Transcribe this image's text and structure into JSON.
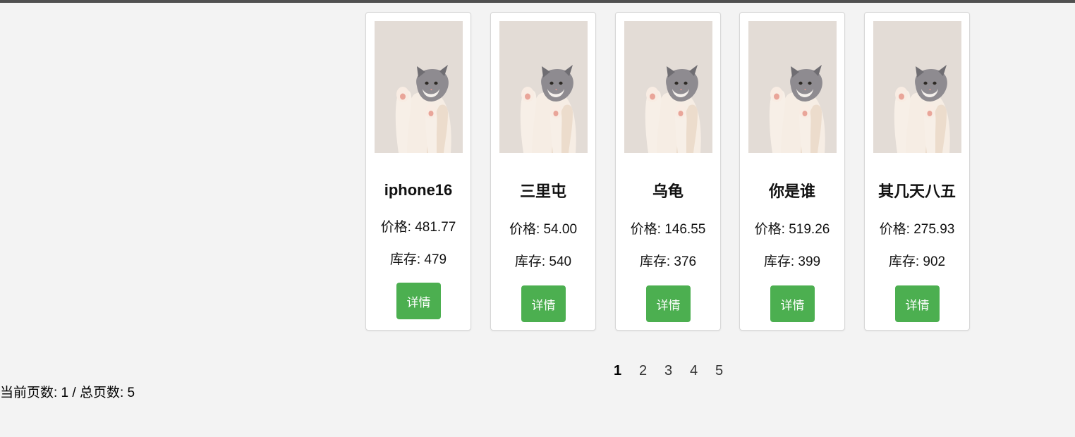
{
  "products": [
    {
      "name": "iphone16",
      "price": "价格: 481.77",
      "stock": "库存: 479",
      "button": "详情",
      "image": "kitten-photo"
    },
    {
      "name": "三里屯",
      "price": "价格: 54.00",
      "stock": "库存: 540",
      "button": "详情",
      "image": "kitten-photo"
    },
    {
      "name": "乌龟",
      "price": "价格: 146.55",
      "stock": "库存: 376",
      "button": "详情",
      "image": "kitten-photo"
    },
    {
      "name": "你是谁",
      "price": "价格: 519.26",
      "stock": "库存: 399",
      "button": "详情",
      "image": "kitten-photo"
    },
    {
      "name": "其几天八五",
      "price": "价格: 275.93",
      "stock": "库存: 902",
      "button": "详情",
      "image": "kitten-photo"
    }
  ],
  "pagination": {
    "pages": [
      "1",
      "2",
      "3",
      "4",
      "5"
    ],
    "current": "1"
  },
  "page_info": "当前页数: 1 / 总页数: 5",
  "colors": {
    "button": "#4caf50",
    "background": "#f3f3f3",
    "card": "#ffffff"
  }
}
